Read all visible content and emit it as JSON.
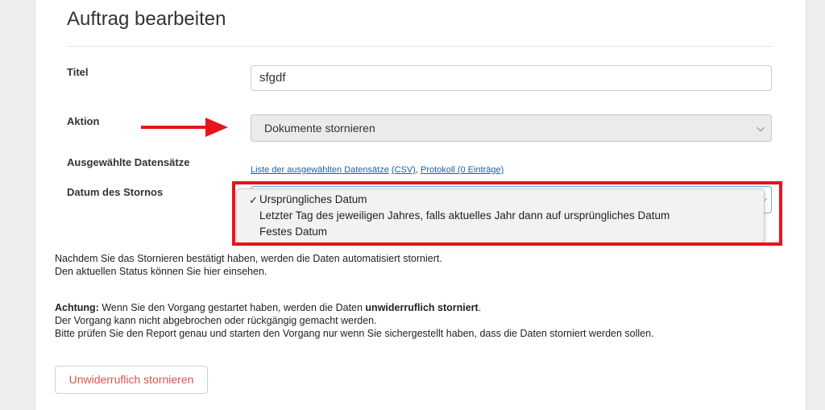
{
  "page": {
    "title": "Auftrag bearbeiten"
  },
  "form": {
    "titel_label": "Titel",
    "titel_value": "sfgdf",
    "aktion_label": "Aktion",
    "aktion_value": "Dokumente stornieren",
    "datensaetze_label": "Ausgewählte Datensätze",
    "link_list": "Liste der ausgewählten Datensätze",
    "link_csv": "(CSV)",
    "link_sep": ", ",
    "link_protokoll": "Protokoll (0 Einträge)",
    "storno_label": "Datum des Stornos"
  },
  "dropdown": {
    "check": "✓",
    "options": [
      "Ursprüngliches Datum",
      "Letzter Tag des jeweiligen Jahres, falls aktuelles Jahr dann auf ursprüngliches Datum",
      "Festes Datum"
    ],
    "selected": "Ursprüngliches Datum"
  },
  "info": {
    "line1": "Nachdem Sie das Stornieren bestätigt haben, werden die Daten automatisiert storniert.",
    "line2": "Den aktuellen Status können Sie hier einsehen."
  },
  "warning": {
    "bold1": "Achtung:",
    "text1": " Wenn Sie den Vorgang gestartet haben, werden die Daten ",
    "bold2": "unwiderruflich storniert",
    "text2": ".",
    "line2": "Der Vorgang kann nicht abgebrochen oder rückgängig gemacht werden.",
    "line3": "Bitte prüfen Sie den Report genau und starten den Vorgang nur wenn Sie sichergestellt haben, dass die Daten storniert werden sollen."
  },
  "button": {
    "label": "Unwiderruflich stornieren"
  },
  "colors": {
    "highlight": "#e8141c",
    "danger": "#d9534f",
    "link": "#1a5fa8"
  },
  "icons": {
    "arrow": "red-arrow-icon",
    "chevron": "chevron-down-icon",
    "check": "checkmark-icon"
  }
}
